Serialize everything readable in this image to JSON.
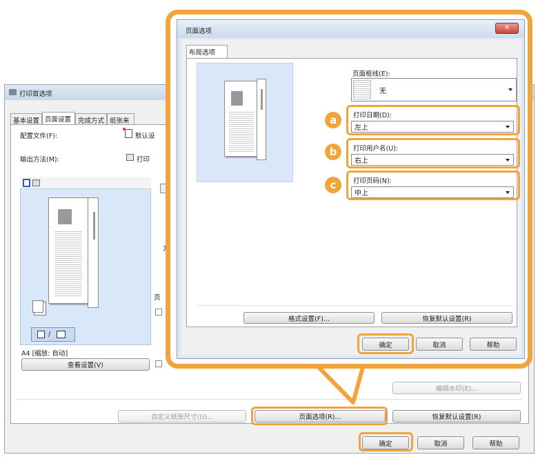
{
  "colors": {
    "highlight": "#f0a43a",
    "preview_bg": "#d8e8f8",
    "title_close": "#c9443a"
  },
  "back_dialog": {
    "title": "打印首选项",
    "tabs": [
      "基本设置",
      "页面设置",
      "完成方式",
      "纸张来"
    ],
    "profile_label": "配置文件(F):",
    "profile_value": "默认设",
    "output_label": "输出方法(M):",
    "output_value": "打印",
    "paper_info": "A4 [缩放: 自动]",
    "view_settings_btn": "查看设置(V)",
    "watermark_btn": "编辑水印(E)...",
    "custom_paper_btn": "自定义纸张尺寸(U)...",
    "page_options_btn": "页面选项(R)...",
    "restore_defaults_btn": "恢复默认设置(R)",
    "ok_btn": "确定",
    "cancel_btn": "取消",
    "help_btn": "帮助",
    "partial_text_1": "页",
    "partial_text_2": "方",
    "partial_check": "√"
  },
  "front_dialog": {
    "title": "页面选项",
    "close_icon": "close-icon",
    "tab": "布局选项",
    "border_label": "页面框线(E):",
    "border_value": "无",
    "date_label": "打印日期(D):",
    "date_value": "左上",
    "user_label": "打印用户名(U):",
    "user_value": "右上",
    "page_num_label": "打印页码(N):",
    "page_num_value": "中上",
    "format_btn": "格式设置(F)...",
    "restore_btn": "恢复默认设置(R)",
    "ok_btn": "确定",
    "cancel_btn": "取消",
    "help_btn": "帮助"
  },
  "badges": {
    "a": "a",
    "b": "b",
    "c": "c"
  }
}
